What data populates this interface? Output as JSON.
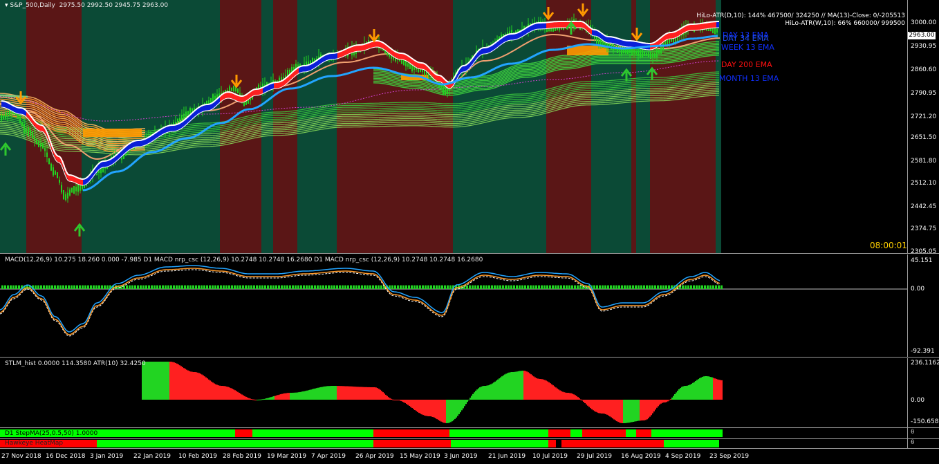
{
  "header": {
    "symbol_label": "S&P_500,Daily",
    "ohlc": "2975.50 2992.50 2945.75 2963.00",
    "menu_icon": "triangle-down-icon"
  },
  "hilo": {
    "line1": "HiLo-ATR(D,10): 144% 467500/ 324250 // MA(13)-Close: 0/-205513",
    "line2": "HiLo-ATR(W,10): 66% 660000/ 999500"
  },
  "ema_labels": {
    "day_13": "DAY 13 EMA",
    "day_34": "DAY 34 EMA",
    "week_13": "WEEK 13 EMA",
    "day_200": "DAY 200 EMA",
    "month_13": "MONTH 13 EMA"
  },
  "timer": "08:00:01",
  "price_axis": {
    "current_price": "2963.00",
    "ticks": [
      "3000.00",
      "2930.95",
      "2860.60",
      "2790.95",
      "2721.20",
      "2651.50",
      "2581.80",
      "2512.10",
      "2442.45",
      "2374.75",
      "2305.05"
    ]
  },
  "macd": {
    "label": "MACD(12,26,9) 10.275 18.260 0.000 -7.985  D1 MACD nrp_csc (12,26,9) 10.2748 10.2748 16.2680  D1 MACD nrp_csc (12,26,9) 10.2748 10.2748 16.2680",
    "ticks": [
      "45.151",
      "0.00",
      "-92.391"
    ]
  },
  "stlm": {
    "label": "STLM_hist 0.0000 114.3580  ATR(10) 32.4250",
    "ticks": [
      "236.1162",
      "0.00",
      "-150.6589"
    ]
  },
  "stepma": {
    "label": "D1 StepMA(25,0.5,50) 1.0000"
  },
  "heatmap": {
    "label": "Hawkeye HeatMap"
  },
  "dates": [
    "27 Nov 2018",
    "16 Dec 2018",
    "3 Jan 2019",
    "22 Jan 2019",
    "10 Feb 2019",
    "28 Feb 2019",
    "19 Mar 2019",
    "7 Apr 2019",
    "26 Apr 2019",
    "15 May 2019",
    "3 Jun 2019",
    "21 Jun 2019",
    "10 Jul 2019",
    "29 Jul 2019",
    "16 Aug 2019",
    "4 Sep 2019",
    "23 Sep 2019"
  ],
  "colors": {
    "bull_bg": "#0b4a36",
    "bear_bg": "#5a1616",
    "up": "#22d422",
    "down": "#ff2020",
    "orange": "#ff9900",
    "blue": "#0a1fd8",
    "cyan": "#22a4ff"
  }
}
